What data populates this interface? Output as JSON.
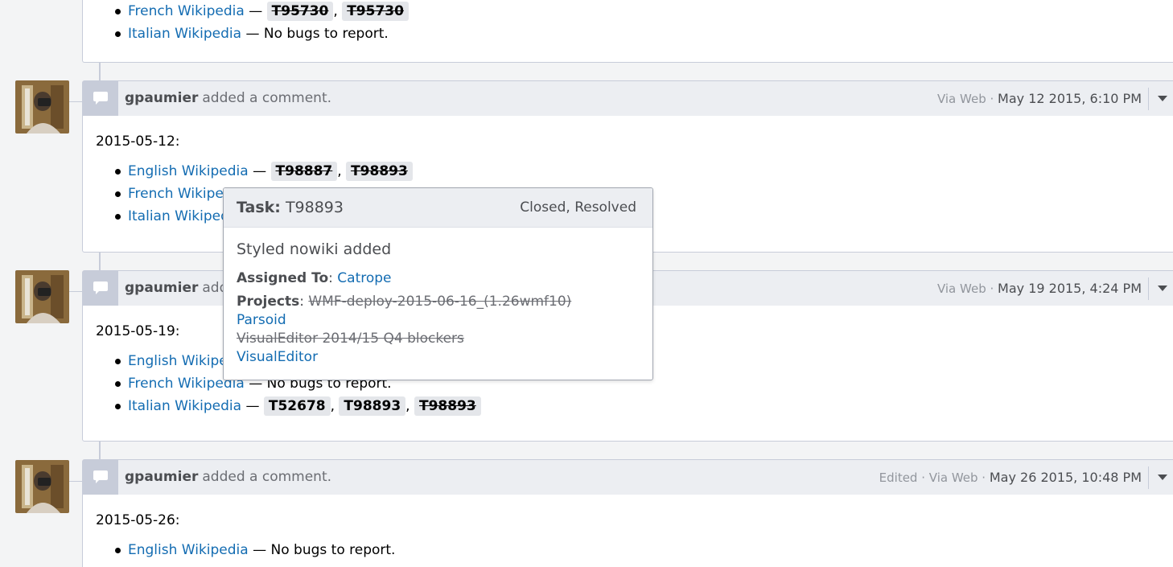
{
  "top_section": {
    "items": [
      {
        "site": "French Wikipedia",
        "sep": " — ",
        "tags": [
          {
            "id": "T95730",
            "closed": true
          },
          {
            "id": "T95730",
            "closed": true
          }
        ]
      },
      {
        "site": "Italian Wikipedia",
        "sep": " — ",
        "text": "No bugs to report."
      }
    ]
  },
  "comments": [
    {
      "author": "gpaumier",
      "action": "added a comment.",
      "meta_prefix": "Via Web",
      "date": "May 12 2015, 6:10 PM",
      "heading": "2015-05-12:",
      "items": [
        {
          "site": "English Wikipedia",
          "tags": [
            {
              "id": "T98887",
              "closed": true
            },
            {
              "id": "T98893",
              "closed": true
            }
          ]
        },
        {
          "site": "French Wikipedi"
        },
        {
          "site": "Italian Wikipedi"
        }
      ]
    },
    {
      "author": "gpaumier",
      "action": "added",
      "meta_prefix": "Via Web",
      "date": "May 19 2015, 4:24 PM",
      "heading": "2015-05-19:",
      "items": [
        {
          "site": "English Wikiped"
        },
        {
          "site": "French Wikipedia",
          "text": "No bugs to report."
        },
        {
          "site": "Italian Wikipedia",
          "tags": [
            {
              "id": "T52678",
              "closed": false
            },
            {
              "id": "T98893",
              "closed": false
            },
            {
              "id": "T98893",
              "closed": true
            }
          ]
        }
      ]
    },
    {
      "author": "gpaumier",
      "action": "added a comment.",
      "meta_prefix": "Edited · Via Web",
      "date": "May 26 2015, 10:48 PM",
      "heading": "2015-05-26:",
      "items": [
        {
          "site": "English Wikipedia",
          "text": "No bugs to report."
        }
      ]
    }
  ],
  "hovercard": {
    "label": "Task:",
    "task_id": "T98893",
    "status": "Closed, Resolved",
    "title": "Styled nowiki added",
    "assigned_label": "Assigned To",
    "assignee": "Catrope",
    "projects_label": "Projects",
    "projects": [
      {
        "name": "WMF-deploy-2015-06-16_(1.26wmf10)",
        "archived": true
      },
      {
        "name": "Parsoid",
        "archived": false
      },
      {
        "name": "VisualEditor 2014/15 Q4 blockers",
        "archived": true
      },
      {
        "name": "VisualEditor",
        "archived": false
      }
    ]
  },
  "colors": {
    "link": "#136cb2",
    "header_bg": "#eceef2",
    "border": "#c7ccd9"
  },
  "icons": {
    "comment": "speech-bubble-icon",
    "menu": "caret-down-icon"
  }
}
